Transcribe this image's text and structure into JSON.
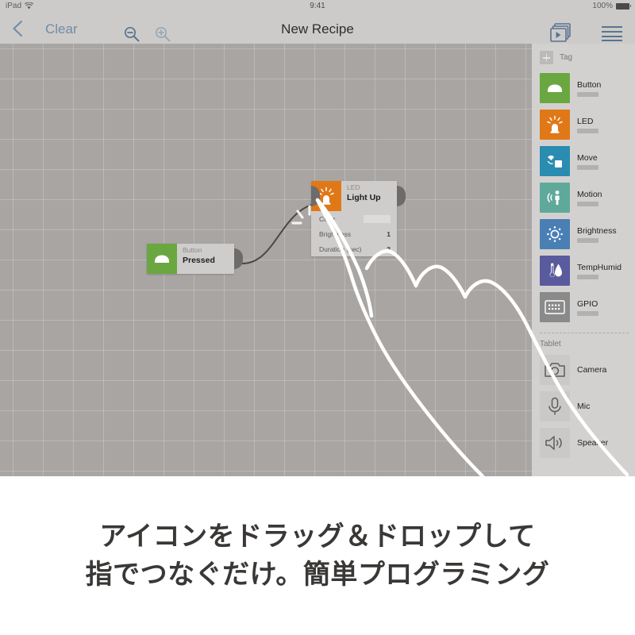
{
  "status_bar": {
    "device": "iPad",
    "wifi_icon": "wifi-icon",
    "time": "9:41",
    "battery_percent": "100%"
  },
  "nav_bar": {
    "back_icon": "chevron-left-icon",
    "clear_label": "Clear",
    "zoom_out_icon": "magnifier-minus-icon",
    "zoom_in_icon": "magnifier-plus-icon",
    "title": "New Recipe",
    "recipes_icon": "play-pages-icon",
    "menu_icon": "hamburger-menu-icon"
  },
  "canvas": {
    "nodes": [
      {
        "kind": "Button",
        "name": "Pressed",
        "icon": "button-icon",
        "color": "#6aa741",
        "params": []
      },
      {
        "kind": "LED",
        "name": "Light Up",
        "icon": "led-icon",
        "color": "#e07818",
        "params": [
          {
            "label": "Color",
            "value": "",
            "type": "swatch"
          },
          {
            "label": "Brightness",
            "value": "1",
            "type": "number"
          },
          {
            "label": "Duration (sec)",
            "value": "3",
            "type": "number"
          }
        ]
      }
    ]
  },
  "panel": {
    "tag_label": "Tag",
    "tag_add_icon": "plus-square-icon",
    "tag_items": [
      {
        "label": "Button",
        "icon": "button-icon",
        "color": "#6aa741"
      },
      {
        "label": "LED",
        "icon": "led-icon",
        "color": "#e07818"
      },
      {
        "label": "Move",
        "icon": "move-icon",
        "color": "#2a8cb0"
      },
      {
        "label": "Motion",
        "icon": "motion-icon",
        "color": "#5fa99b"
      },
      {
        "label": "Brightness",
        "icon": "brightness-icon",
        "color": "#4a7fb5"
      },
      {
        "label": "TempHumid",
        "icon": "temphumid-icon",
        "color": "#5a5a9e"
      },
      {
        "label": "GPIO",
        "icon": "gpio-icon",
        "color": "#8a8a8a"
      }
    ],
    "tablet_label": "Tablet",
    "tablet_items": [
      {
        "label": "Camera",
        "icon": "camera-icon"
      },
      {
        "label": "Mic",
        "icon": "mic-icon"
      },
      {
        "label": "Speaker",
        "icon": "speaker-icon"
      }
    ]
  },
  "caption": {
    "line1": "アイコンをドラッグ＆ドロップして",
    "line2": "指でつなぐだけ。簡単プログラミング"
  }
}
